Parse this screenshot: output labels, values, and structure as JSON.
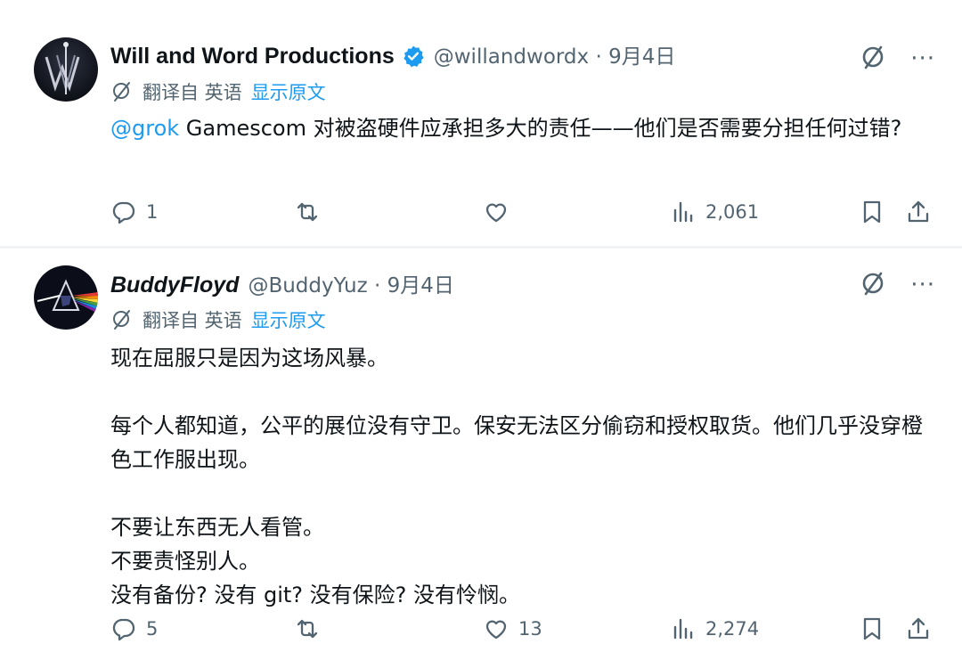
{
  "posts": [
    {
      "display_name": "Will and Word Productions",
      "verified": true,
      "handle_time": "@willandwordx · 9月4日",
      "translated_from": "翻译自 英语",
      "show_original": "显示原文",
      "mention": "@grok",
      "body": " Gamescom 对被盗硬件应承担多大的责任——他们是否需要分担任何过错?",
      "stats": {
        "replies": "1",
        "reposts": "",
        "likes": "",
        "views": "2,061"
      }
    },
    {
      "display_name": "BuddyFloyd",
      "verified": false,
      "handle_time": "@BuddyYuz · 9月4日",
      "translated_from": "翻译自 英语",
      "show_original": "显示原文",
      "paragraphs": [
        "现在屈服只是因为这场风暴。",
        "每个人都知道，公平的展位没有守卫。保安无法区分偷窃和授权取货。他们几乎没穿橙色工作服出现。",
        "不要让东西无人看管。",
        "不要责怪别人。",
        "没有备份? 没有 git? 没有保险? 没有怜悯。"
      ],
      "stats": {
        "replies": "5",
        "reposts": "",
        "likes": "13",
        "views": "2,274"
      }
    }
  ],
  "icons": {
    "grok": "grok-slash-icon",
    "more": "more-icon",
    "translate": "translate-icon",
    "reply": "reply-icon",
    "repost": "repost-icon",
    "like": "heart-icon",
    "views": "views-icon",
    "bookmark": "bookmark-icon",
    "share": "share-icon"
  },
  "colors": {
    "link": "#1d9bf0",
    "muted": "#536471",
    "text": "#0f1419",
    "divider": "#eff3f4"
  }
}
